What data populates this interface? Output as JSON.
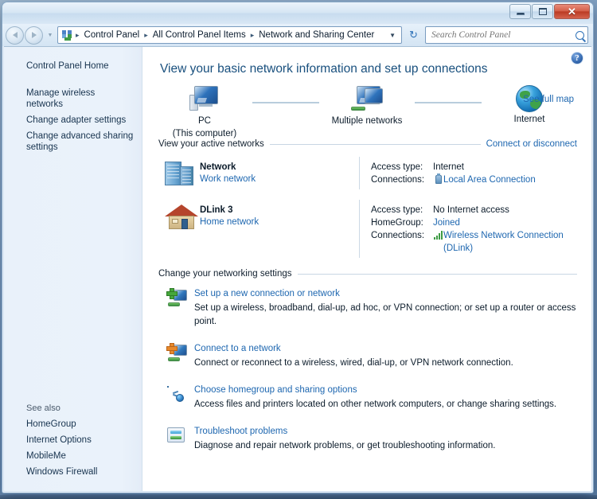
{
  "window": {
    "controls": {
      "minimize": "minimize",
      "maximize": "maximize",
      "close": "✕"
    }
  },
  "navbar": {
    "back_tooltip": "Back",
    "forward_tooltip": "Forward",
    "breadcrumbs": [
      "Control Panel",
      "All Control Panel Items",
      "Network and Sharing Center"
    ],
    "separator": "▸",
    "dropdown_caret": "▼",
    "refresh_glyph": "↻",
    "search": {
      "placeholder": "Search Control Panel",
      "value": ""
    }
  },
  "sidebar": {
    "home_label": "Control Panel Home",
    "items": [
      {
        "label": "Manage wireless networks"
      },
      {
        "label": "Change adapter settings"
      },
      {
        "label": "Change advanced sharing settings"
      }
    ],
    "see_also_label": "See also",
    "see_also_items": [
      {
        "label": "HomeGroup"
      },
      {
        "label": "Internet Options"
      },
      {
        "label": "MobileMe"
      },
      {
        "label": "Windows Firewall"
      }
    ]
  },
  "main": {
    "help_glyph": "?",
    "page_title": "View your basic network information and set up connections",
    "network_map": {
      "see_full_map": "See full map",
      "nodes": [
        {
          "icon": "computer-icon",
          "label": "PC",
          "sublabel": "(This computer)"
        },
        {
          "icon": "multiple-networks-icon",
          "label": "Multiple networks",
          "sublabel": ""
        },
        {
          "icon": "globe-icon",
          "label": "Internet",
          "sublabel": ""
        }
      ]
    },
    "active_networks": {
      "section_label": "View your active networks",
      "action_link": "Connect or disconnect",
      "networks": [
        {
          "icon": "server-network-icon",
          "name": "Network",
          "type": "Work network",
          "details": [
            {
              "label": "Access type:",
              "value": "Internet",
              "link": false,
              "icon": ""
            },
            {
              "label": "Connections:",
              "value": "Local Area Connection",
              "link": true,
              "icon": "lan-icon"
            }
          ]
        },
        {
          "icon": "home-network-icon",
          "name": "DLink  3",
          "type": "Home network",
          "details": [
            {
              "label": "Access type:",
              "value": "No Internet access",
              "link": false,
              "icon": ""
            },
            {
              "label": "HomeGroup:",
              "value": "Joined",
              "link": true,
              "icon": ""
            },
            {
              "label": "Connections:",
              "value": "Wireless Network Connection",
              "value2": "(DLink)",
              "link": true,
              "icon": "wifi-icon"
            }
          ]
        }
      ]
    },
    "settings": {
      "section_label": "Change your networking settings",
      "items": [
        {
          "icon": "new-connection-icon",
          "link": "Set up a new connection or network",
          "desc": "Set up a wireless, broadband, dial-up, ad hoc, or VPN connection; or set up a router or access point."
        },
        {
          "icon": "connect-network-icon",
          "link": "Connect to a network",
          "desc": "Connect or reconnect to a wireless, wired, dial-up, or VPN network connection."
        },
        {
          "icon": "homegroup-sharing-icon",
          "link": "Choose homegroup and sharing options",
          "desc": "Access files and printers located on other network computers, or change sharing settings."
        },
        {
          "icon": "troubleshoot-icon",
          "link": "Troubleshoot problems",
          "desc": "Diagnose and repair network problems, or get troubleshooting information."
        }
      ]
    }
  },
  "colors": {
    "link": "#1e67b0",
    "title": "#19507e",
    "sidebar_bg": "#eaf2fb",
    "close_button": "#bb3b24"
  }
}
